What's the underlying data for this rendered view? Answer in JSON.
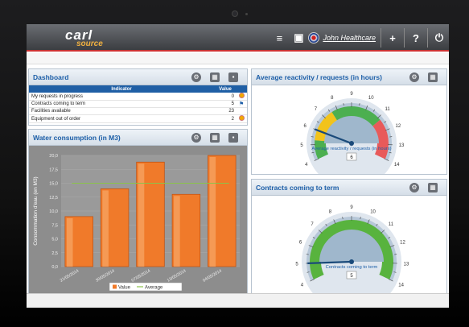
{
  "app": {
    "logo_main": "carl",
    "logo_sub": "source",
    "user": "John Healthcare",
    "colors": {
      "accent": "#1d5fa8",
      "header_red": "#cc3333",
      "bar": "#f07a2a"
    }
  },
  "toolbar": {
    "menu_icon": "menu-icon",
    "windows_icon": "windows-icon",
    "flag_icon": "uk-flag-icon",
    "add": "+",
    "help": "?",
    "power": "⏻"
  },
  "dashboard": {
    "title": "Dashboard",
    "col_indicator": "Indicator",
    "col_value": "Value",
    "rows": [
      {
        "label": "My requests in progress",
        "value": "0"
      },
      {
        "label": "Contracts coming to term",
        "value": "5"
      },
      {
        "label": "Facilities available",
        "value": "23"
      },
      {
        "label": "Equipment out of order",
        "value": "2"
      }
    ]
  },
  "water": {
    "title": "Water consumption (in M3)"
  },
  "reactivity": {
    "title": "Average reactivity / requests (in hours)",
    "label": "Average reactivity / requests (in hours)",
    "value": "6"
  },
  "contracts": {
    "title": "Contracts coming to term",
    "label": "Contracts coming to term",
    "value": "5"
  },
  "chart_data": {
    "type": "bar",
    "categories": [
      "21/05/2014",
      "30/05/2014",
      "07/05/2014",
      "13/05/2014",
      "04/05/2014"
    ],
    "series": [
      {
        "name": "Value",
        "values": [
          9.0,
          14.0,
          18.8,
          13.0,
          20.0
        ]
      },
      {
        "name": "Average",
        "values": [
          15,
          15,
          15,
          15,
          15
        ]
      }
    ],
    "ylabel": "Consommation d'eau (en M3)",
    "yticks": [
      "0,0",
      "2,5",
      "5,0",
      "7,5",
      "10,0",
      "12,5",
      "15,0",
      "17,5",
      "20,0"
    ],
    "ylim": [
      0,
      20
    ],
    "legend": [
      "Value",
      "Average"
    ],
    "grid": true
  },
  "gauges": {
    "ticks": [
      "4",
      "5",
      "6",
      "7",
      "8",
      "9",
      "10",
      "11",
      "12",
      "13",
      "14"
    ]
  }
}
